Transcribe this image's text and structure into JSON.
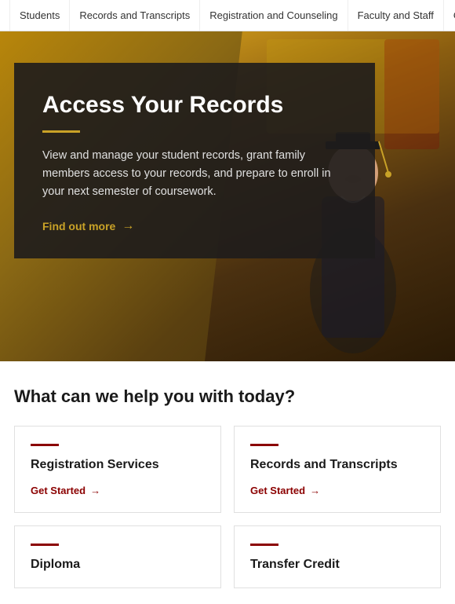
{
  "nav": {
    "items": [
      {
        "id": "students",
        "label": "Students",
        "active": false
      },
      {
        "id": "records-transcripts",
        "label": "Records and Transcripts",
        "active": false
      },
      {
        "id": "registration-counseling",
        "label": "Registration and Counseling",
        "active": false
      },
      {
        "id": "faculty-staff",
        "label": "Faculty and Staff",
        "active": false
      },
      {
        "id": "oasis",
        "label": "OASIS",
        "active": false
      }
    ]
  },
  "hero": {
    "title": "Access Your Records",
    "description": "View and manage your student records, grant family members access to your records, and prepare to enroll in your next semester of coursework.",
    "link_label": "Find out more",
    "divider_color": "#c9a227"
  },
  "section": {
    "heading": "What can we help you with today?"
  },
  "cards": [
    {
      "id": "registration-services",
      "title": "Registration Services",
      "link": "Get Started"
    },
    {
      "id": "records-transcripts-card",
      "title": "Records and Transcripts",
      "link": "Get Started"
    }
  ],
  "cards_partial": [
    {
      "id": "diploma",
      "title": "Diploma"
    },
    {
      "id": "transfer-credit",
      "title": "Transfer Credit"
    }
  ],
  "colors": {
    "accent_gold": "#c9a227",
    "accent_red": "#8b0000",
    "nav_text": "#333333",
    "hero_overlay": "rgba(30,28,28,0.90)"
  },
  "icons": {
    "arrow_right": "→"
  }
}
